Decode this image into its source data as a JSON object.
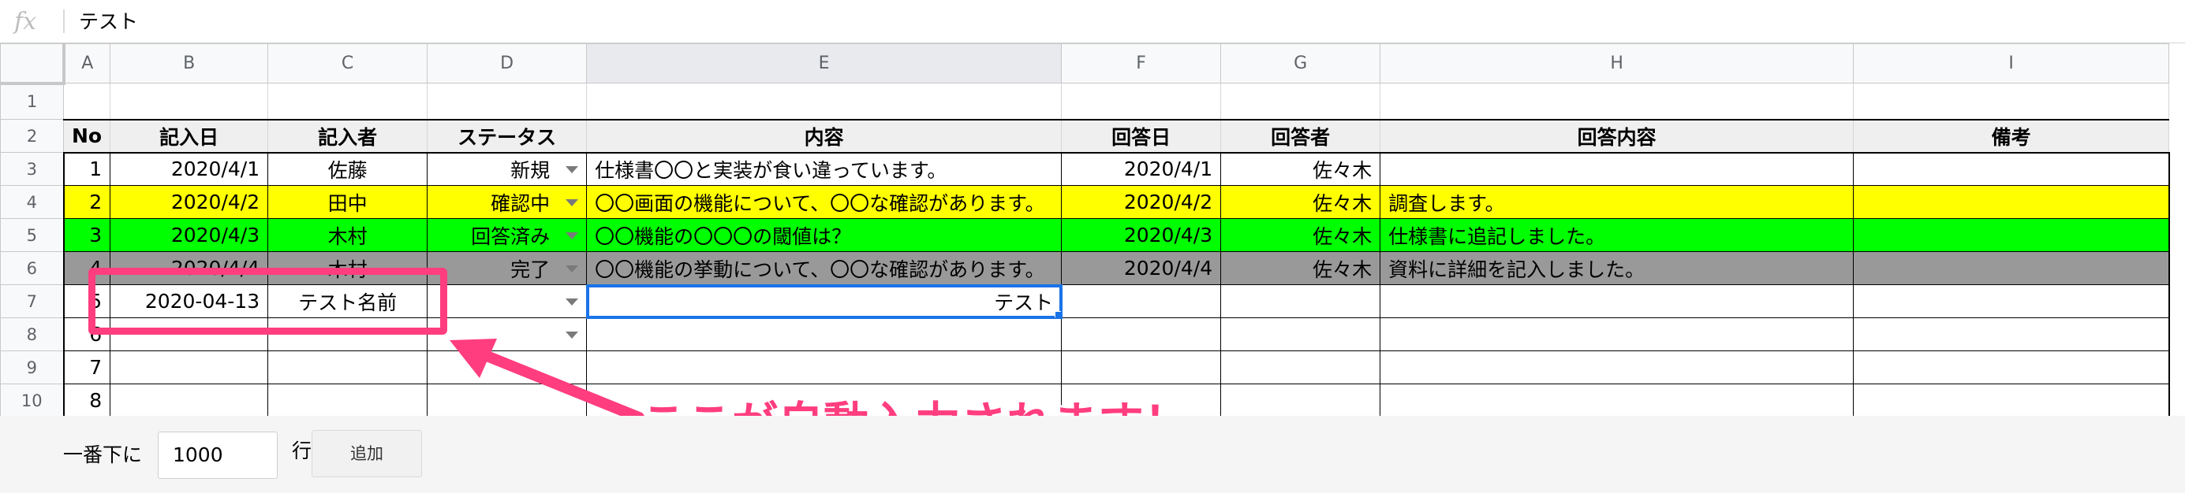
{
  "formula_bar": {
    "fx_label": "fx",
    "value": "テスト"
  },
  "columns": [
    "A",
    "B",
    "C",
    "D",
    "E",
    "F",
    "G",
    "H",
    "I"
  ],
  "header_row": [
    "No",
    "記入日",
    "記入者",
    "ステータス",
    "内容",
    "回答日",
    "回答者",
    "回答内容",
    "備考"
  ],
  "rows": [
    {
      "row": "3",
      "no": "1",
      "date": "2020/4/1",
      "author": "佐藤",
      "status": "新規",
      "content": "仕様書〇〇と実装が食い違っています。",
      "answer_date": "2020/4/1",
      "answerer": "佐々木",
      "answer": "",
      "note": ""
    },
    {
      "row": "4",
      "no": "2",
      "date": "2020/4/2",
      "author": "田中",
      "status": "確認中",
      "content": "〇〇画面の機能について、〇〇な確認があります。",
      "answer_date": "2020/4/2",
      "answerer": "佐々木",
      "answer": "調査します。",
      "note": ""
    },
    {
      "row": "5",
      "no": "3",
      "date": "2020/4/3",
      "author": "木村",
      "status": "回答済み",
      "content": "〇〇機能の〇〇〇の閾値は？",
      "answer_date": "2020/4/3",
      "answerer": "佐々木",
      "answer": "仕様書に追記しました。",
      "note": ""
    },
    {
      "row": "6",
      "no": "4",
      "date": "2020/4/4",
      "author": "木村",
      "status": "完了",
      "content": "〇〇機能の挙動について、〇〇な確認があります。",
      "answer_date": "2020/4/4",
      "answerer": "佐々木",
      "answer": "資料に詳細を記入しました。",
      "note": ""
    },
    {
      "row": "7",
      "no": "5",
      "date": "2020-04-13",
      "author": "テスト名前",
      "status": "",
      "content": "テスト",
      "answer_date": "",
      "answerer": "",
      "answer": "",
      "note": ""
    },
    {
      "row": "8",
      "no": "6",
      "date": "",
      "author": "",
      "status": "",
      "content": "",
      "answer_date": "",
      "answerer": "",
      "answer": "",
      "note": ""
    },
    {
      "row": "9",
      "no": "7",
      "date": "",
      "author": "",
      "status": "",
      "content": "",
      "answer_date": "",
      "answerer": "",
      "answer": "",
      "note": ""
    },
    {
      "row": "10",
      "no": "8",
      "date": "",
      "author": "",
      "status": "",
      "content": "",
      "answer_date": "",
      "answerer": "",
      "answer": "",
      "note": ""
    }
  ],
  "row_numbers": [
    "1",
    "2"
  ],
  "bottom_bar": {
    "label_before": "一番下に",
    "input_value": "1000",
    "label_after": "行",
    "add_button": "追加"
  },
  "annotation": {
    "text": "ここが自動入力されます！",
    "color": "#ff3d7f"
  },
  "colors": {
    "yellow": "#ffff00",
    "green": "#00ff00",
    "gray": "#999999",
    "selection": "#1a73e8"
  }
}
